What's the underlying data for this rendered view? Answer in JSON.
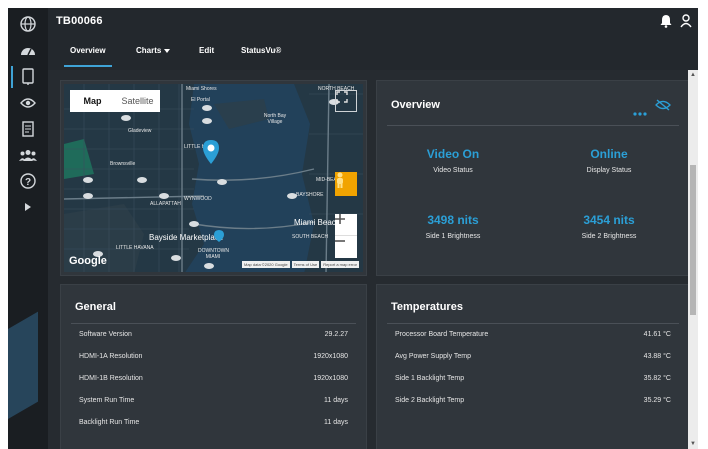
{
  "header": {
    "device_id": "TB00066"
  },
  "tabs": [
    {
      "label": "Overview"
    },
    {
      "label": "Charts"
    },
    {
      "label": "Edit"
    },
    {
      "label": "StatusVu®"
    }
  ],
  "map": {
    "map_type_options": [
      "Map",
      "Satellite"
    ],
    "selected_map_type": "Map",
    "labels": [
      "Miami Shores",
      "El Portal",
      "North Bay Village",
      "Gladeview",
      "LITTLE HAITI",
      "Brownsville",
      "ALLAPATTAH",
      "WYNWOOD",
      "MID-BEACH",
      "BAYSHORE",
      "Miami Beach",
      "SOUTH BEACH",
      "Bayside Marketplace",
      "LITTLE HAVANA",
      "DOWNTOWN MIAMI",
      "NORTH BEACH"
    ],
    "google_logo": "Google",
    "attribution": [
      "Map data ©2020 Google",
      "Terms of Use",
      "Report a map error"
    ]
  },
  "overview": {
    "title": "Overview",
    "metrics": [
      {
        "value": "Video On",
        "label": "Video Status"
      },
      {
        "value": "Online",
        "label": "Display Status"
      },
      {
        "value": "3498 nits",
        "label": "Side 1 Brightness"
      },
      {
        "value": "3454 nits",
        "label": "Side 2 Brightness"
      }
    ]
  },
  "general": {
    "title": "General",
    "rows": [
      {
        "key": "Software Version",
        "value": "29.2.27"
      },
      {
        "key": "HDMI-1A Resolution",
        "value": "1920x1080"
      },
      {
        "key": "HDMI-1B Resolution",
        "value": "1920x1080"
      },
      {
        "key": "System Run Time",
        "value": "11 days"
      },
      {
        "key": "Backlight Run Time",
        "value": "11 days"
      }
    ]
  },
  "temperatures": {
    "title": "Temperatures",
    "rows": [
      {
        "key": "Processor Board Temperature",
        "value": "41.61 °C"
      },
      {
        "key": "Avg Power Supply Temp",
        "value": "43.88 °C"
      },
      {
        "key": "Side 1 Backlight Temp",
        "value": "35.82 °C"
      },
      {
        "key": "Side 2 Backlight Temp",
        "value": "35.29 °C"
      }
    ]
  },
  "colors": {
    "accent": "#2b9fd6",
    "background": "#1e2327",
    "card": "#30363c"
  },
  "icons": [
    "globe-icon",
    "dashboard-icon",
    "display-icon",
    "eye-icon",
    "document-icon",
    "users-icon",
    "help-icon",
    "expand-arrow-icon",
    "bell-icon",
    "user-icon",
    "more-icon",
    "hide-icon",
    "fullscreen-icon",
    "pegman-icon",
    "zoom-in-icon",
    "zoom-out-icon",
    "map-pin-icon"
  ]
}
